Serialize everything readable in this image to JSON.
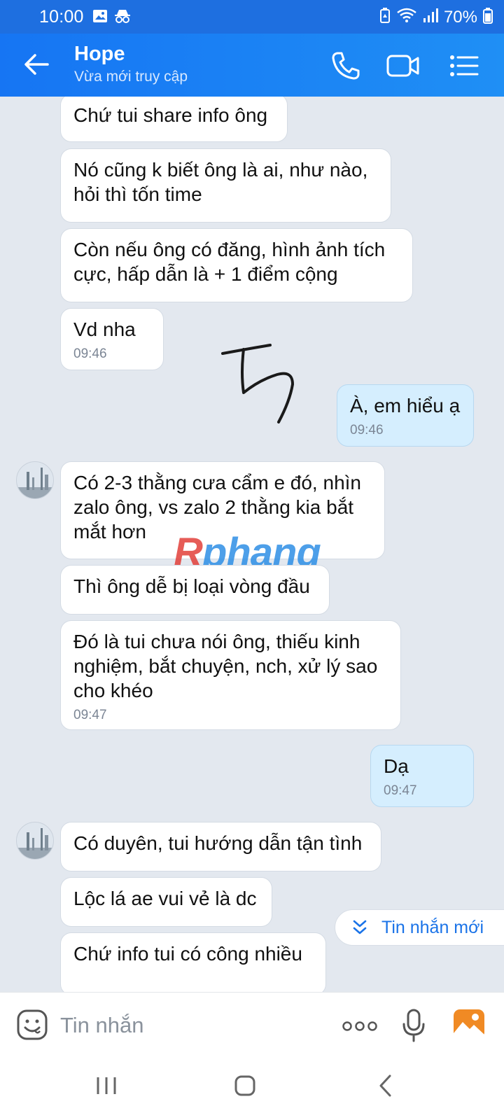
{
  "status_bar": {
    "time": "10:00",
    "battery": "70%",
    "icons": [
      "gallery-icon",
      "incognito-icon",
      "battery-saver-icon",
      "wifi-icon",
      "signal-icon",
      "battery-icon"
    ]
  },
  "header": {
    "contact_name": "Hope",
    "contact_status": "Vừa mới truy cập",
    "icons": [
      "back-arrow-icon",
      "phone-icon",
      "video-call-icon",
      "list-menu-icon"
    ]
  },
  "messages": [
    {
      "direction": "in",
      "text": "Chứ tui share info ông"
    },
    {
      "direction": "in",
      "text": "Nó cũng k biết ông là ai, như nào, hỏi thì tốn time"
    },
    {
      "direction": "in",
      "text": "Còn nếu ông có đăng, hình ảnh tích cực, hấp dẫn là + 1 điểm cộng"
    },
    {
      "direction": "in",
      "text": "Vd nha",
      "time": "09:46"
    },
    {
      "direction": "out",
      "text": "À, em hiểu ạ",
      "time": "09:46"
    },
    {
      "direction": "in",
      "text": "Có 2-3 thằng cưa cẩm e đó, nhìn zalo ông, vs zalo 2 thằng kia bắt mắt hơn",
      "avatar": true
    },
    {
      "direction": "in",
      "text": "Thì ông dễ bị loại vòng đầu"
    },
    {
      "direction": "in",
      "text": "Đó là tui chưa nói ông, thiếu kinh nghiệm, bắt chuyện, nch, xử lý sao cho khéo",
      "time": "09:47"
    },
    {
      "direction": "out",
      "text": "Dạ",
      "time": "09:47"
    },
    {
      "direction": "in",
      "text": "Có duyên, tui hướng dẫn tận tình",
      "avatar": true
    },
    {
      "direction": "in",
      "text": "Lộc lá ae vui vẻ là dc"
    },
    {
      "direction": "in",
      "text": "Chứ info tui có công nhiều"
    }
  ],
  "new_message_button": "Tin nhắn mới",
  "watermark": {
    "part1": "R",
    "part2": "phang"
  },
  "input_bar": {
    "placeholder": "Tin nhắn",
    "icons": [
      "emoji-icon",
      "more-dots-icon",
      "microphone-icon",
      "image-icon"
    ]
  },
  "nav_bar": {
    "icons": [
      "recent-apps-icon",
      "home-icon",
      "back-icon"
    ]
  },
  "colors": {
    "header": "#1675f3",
    "incoming_bubble": "#ffffff",
    "outgoing_bubble": "#d5eefe",
    "chat_background": "#e3e8ef",
    "accent": "#1a73e8"
  }
}
